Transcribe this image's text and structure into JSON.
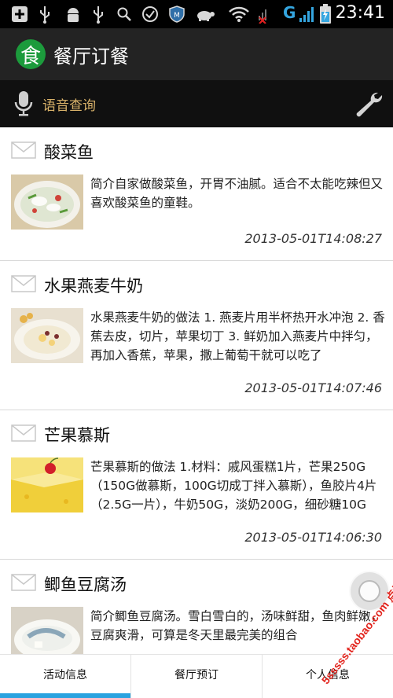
{
  "status_bar": {
    "network": "G",
    "time": "23:41",
    "icons": [
      "add-icon",
      "usb-icon",
      "android-icon",
      "usb-icon",
      "search-icon",
      "check-circle-icon",
      "shield-icon",
      "tortoise-icon",
      "wifi-icon",
      "no-signal-icon",
      "signal-icon",
      "battery-charging-icon"
    ]
  },
  "app_bar": {
    "logo_char": "食",
    "title": "餐厅订餐"
  },
  "search": {
    "label": "语音查询"
  },
  "feed": [
    {
      "title": "酸菜鱼",
      "description": "简介自家做酸菜鱼，开胃不油腻。适合不太能吃辣但又喜欢酸菜鱼的童鞋。",
      "timestamp": "2013-05-01T14:08:27"
    },
    {
      "title": "水果燕麦牛奶",
      "description": "水果燕麦牛奶的做法 1. 燕麦片用半杯热开水冲泡 2. 香蕉去皮，切片，苹果切丁 3. 鲜奶加入燕麦片中拌匀，再加入香蕉，苹果，撒上葡萄干就可以吃了",
      "timestamp": "2013-05-01T14:07:46"
    },
    {
      "title": "芒果慕斯",
      "description": "芒果慕斯的做法 1.材料：戚风蛋糕1片，芒果250G（150G做慕斯，100G切成丁拌入慕斯），鱼胶片4片（2.5G一片），牛奶50G，淡奶200G，细砂糖10G",
      "timestamp": "2013-05-01T14:06:30"
    },
    {
      "title": "鲫鱼豆腐汤",
      "description": "简介鲫鱼豆腐汤。雪白雪白的，汤味鲜甜，鱼肉鲜嫩，豆腐爽滑，可算是冬天里最完美的组合",
      "timestamp": ""
    }
  ],
  "tabs": [
    {
      "label": "活动信息",
      "active": true
    },
    {
      "label": "餐厅预订",
      "active": false
    },
    {
      "label": "个人信息",
      "active": false
    }
  ],
  "watermark": "5sssss.taobao.com 点拓工作室",
  "colors": {
    "accent": "#2aa3e0",
    "logo_green": "#1c9b3c",
    "search_label": "#d9b26a",
    "watermark_red": "#e2241d"
  }
}
